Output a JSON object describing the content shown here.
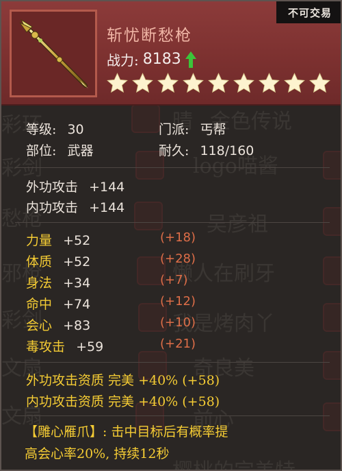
{
  "item": {
    "name": "斩忧断愁枪",
    "trade_badge": "不可交易",
    "power_label": "战力:",
    "power_value": "8183",
    "stars": 9,
    "icon": "golden-spear-icon"
  },
  "info": {
    "level_label": "等级:",
    "level_value": "30",
    "sect_label": "门派:",
    "sect_value": "丐帮",
    "slot_label": "部位:",
    "slot_value": "武器",
    "durability_label": "耐久:",
    "durability_value": "118/160"
  },
  "attack": [
    {
      "label": "外功攻击",
      "value": "+144"
    },
    {
      "label": "内功攻击",
      "value": "+144"
    }
  ],
  "attributes": [
    {
      "label": "力量",
      "value": "+52",
      "bonus": "(+18)"
    },
    {
      "label": "体质",
      "value": "+52",
      "bonus": "(+28)"
    },
    {
      "label": "身法",
      "value": "+34",
      "bonus": "(+7)"
    },
    {
      "label": "命中",
      "value": "+74",
      "bonus": "(+12)"
    },
    {
      "label": "会心",
      "value": "+83",
      "bonus": "(+10)"
    },
    {
      "label": "毒攻击",
      "value": "+59",
      "bonus": "(+21)"
    }
  ],
  "aptitude": [
    {
      "text": "外功攻击资质 完美 +40% (+58)"
    },
    {
      "text": "内功攻击资质 完美 +40% (+58)"
    }
  ],
  "skill": {
    "line1": "【雕心雁爪】: 击中目标后有概率提",
    "line2": "高会心率20%, 持续12秒"
  },
  "background_ghost": [
    "彩环",
    "晴",
    "金色传说",
    "彩剑",
    "logo喵酱",
    "愁枪",
    "吴彦祖",
    "邪枪",
    "懒人在刷牙",
    "彩剑",
    "我是烤肉丫",
    "文扇",
    "奇良美",
    "文扇",
    "前心",
    "樱桃的完美特"
  ],
  "colors": {
    "header": "#8c3b3a",
    "gold": "#f5cc34",
    "bonus": "#de6e48",
    "name": "#f0b6a6",
    "arrow": "#3cc43a"
  }
}
